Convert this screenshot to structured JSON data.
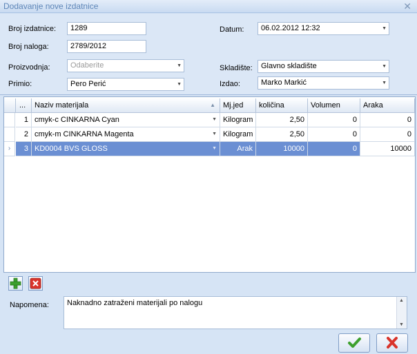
{
  "window": {
    "title": "Dodavanje nove izdatnice",
    "close_glyph": "✕"
  },
  "form": {
    "broj_izdatnice": {
      "label": "Broj izdatnice:",
      "value": "1289"
    },
    "broj_naloga": {
      "label": "Broj naloga:",
      "value": "2789/2012"
    },
    "proizvodnja": {
      "label": "Proizvodnja:",
      "value": "Odaberite"
    },
    "primio": {
      "label": "Primio:",
      "value": "Pero Perić"
    },
    "datum": {
      "label": "Datum:",
      "value": "06.02.2012 12:32"
    },
    "skladiste": {
      "label": "Skladište:",
      "value": "Glavno skladište"
    },
    "izdao": {
      "label": "Izdao:",
      "value": "Marko Markić"
    }
  },
  "grid": {
    "columns": {
      "num": "...",
      "naziv": "Naziv materijala",
      "mjed": "Mj.jed",
      "kolicina": "količina",
      "volumen": "Volumen",
      "araka": "Araka"
    },
    "rows": [
      {
        "num": "1",
        "naziv": "cmyk-c CINKARNA Cyan",
        "mjed": "Kilogram",
        "kolicina": "2,50",
        "volumen": "0",
        "araka": "0"
      },
      {
        "num": "2",
        "naziv": "cmyk-m CINKARNA Magenta",
        "mjed": "Kilogram",
        "kolicina": "2,50",
        "volumen": "0",
        "araka": "0"
      },
      {
        "num": "3",
        "naziv": "KD0004  BVS GLOSS",
        "mjed": "Arak",
        "kolicina": "10000",
        "volumen": "0",
        "araka": "10000"
      }
    ],
    "selected_row_marker": "›"
  },
  "notes": {
    "label": "Napomena:",
    "value": "Naknadno zatraženi materijali po nalogu"
  },
  "colors": {
    "accent": "#6b8fd3",
    "add_icon": "#3da02e",
    "remove_icon": "#d9342b",
    "ok_icon": "#3da02e",
    "cancel_icon": "#d9342b"
  }
}
